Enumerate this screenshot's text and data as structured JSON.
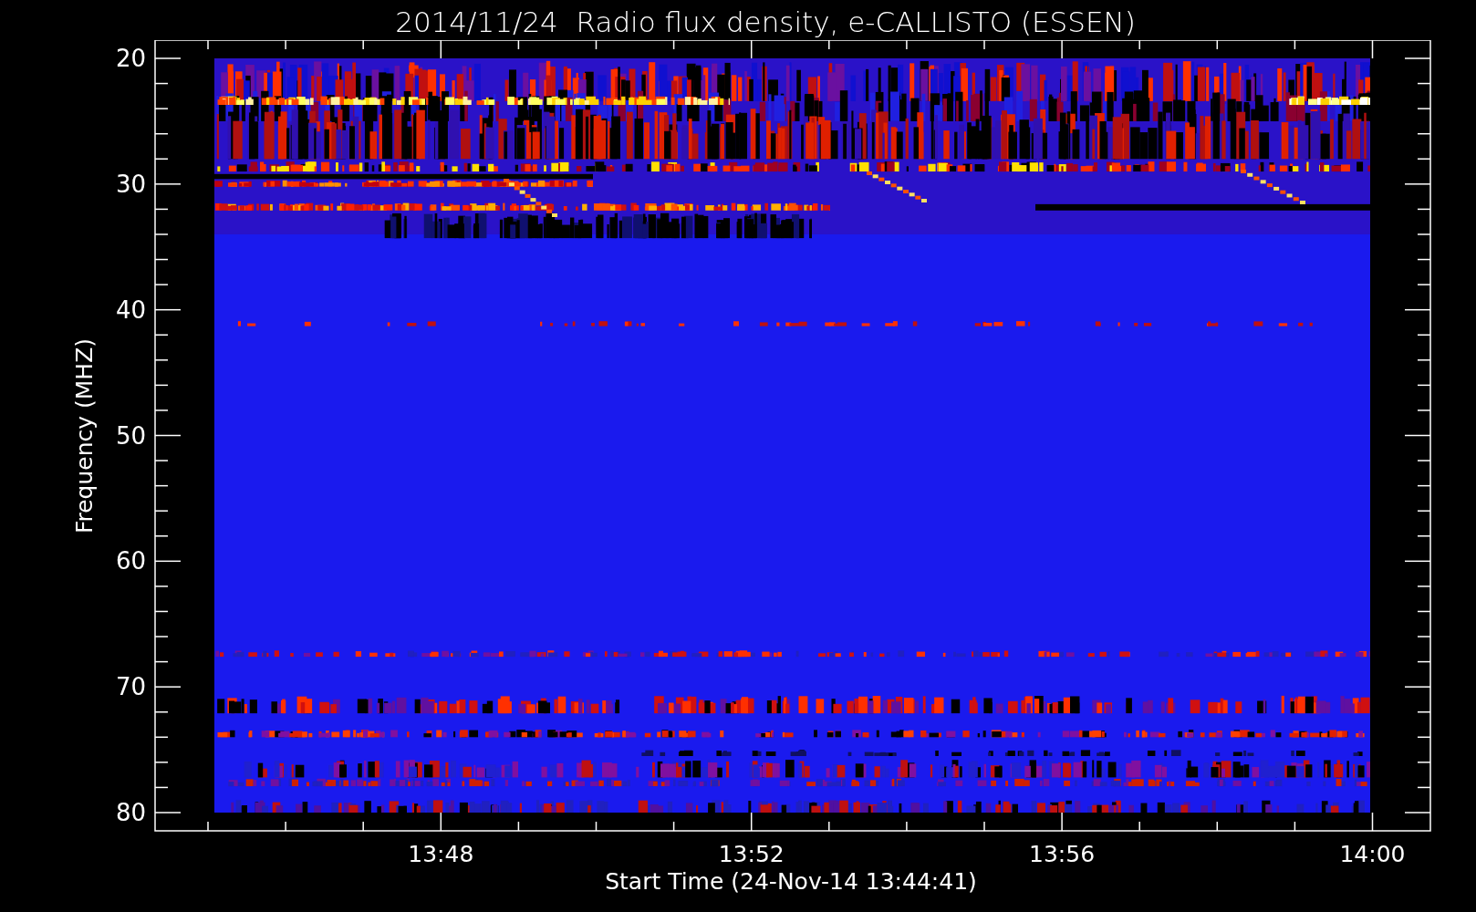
{
  "title": "2014/11/24  Radio flux density, e-CALLISTO (ESSEN)",
  "y_axis": {
    "label": "Frequency (MHZ)",
    "ticks": [
      "20",
      "30",
      "40",
      "50",
      "60",
      "70",
      "80"
    ]
  },
  "x_axis": {
    "label": "Start Time (24-Nov-14 13:44:41)",
    "ticks": [
      "13:48",
      "13:52",
      "13:56",
      "14:00"
    ]
  }
}
